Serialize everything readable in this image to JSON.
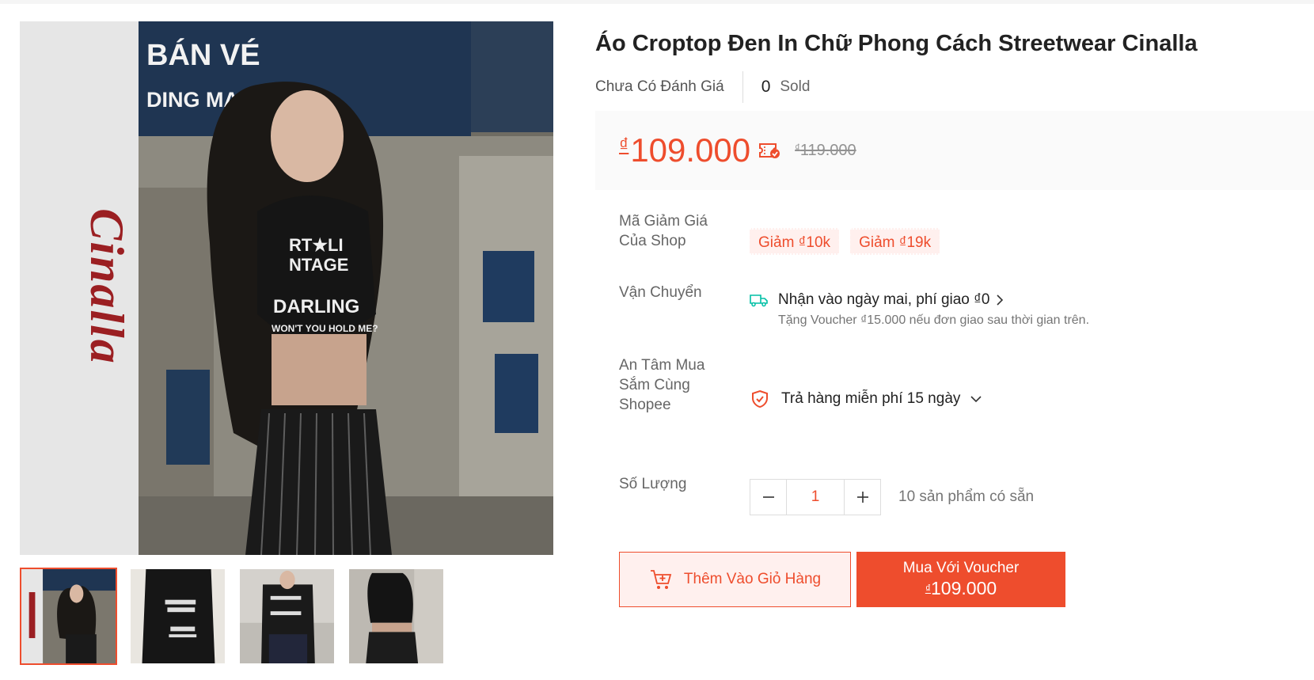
{
  "product": {
    "title": "Áo Croptop Đen In Chữ Phong Cách Streetwear Cinalla",
    "rating_text": "Chưa Có Đánh Giá",
    "sold_count": "0",
    "sold_label": "Sold"
  },
  "price": {
    "currency": "₫",
    "current": "109.000",
    "original_currency": "₫",
    "original": "119.000"
  },
  "gallery": {
    "brand_text": "Cinalla",
    "sign_line1": "BÁN VÉ",
    "sign_line2": "DING MACHINE",
    "shirt_line1": "RT★LI",
    "shirt_line2": "NTAGE",
    "shirt_line3": "DARLING",
    "shirt_line4": "WON'T YOU HOLD ME?",
    "thumbnails": [
      {
        "name": "thumbnail-1",
        "active": true
      },
      {
        "name": "thumbnail-2",
        "active": false
      },
      {
        "name": "thumbnail-3",
        "active": false
      },
      {
        "name": "thumbnail-4",
        "active": false
      }
    ]
  },
  "vouchers": {
    "label": "Mã Giảm Giá Của Shop",
    "items": [
      "Giảm ₫10k",
      "Giảm ₫19k"
    ]
  },
  "shipping": {
    "label": "Vận Chuyển",
    "main": "Nhận vào ngày mai, phí giao ₫0",
    "sub": "Tặng Voucher ₫15.000 nếu đơn giao sau thời gian trên."
  },
  "guarantee": {
    "label": "An Tâm Mua Sắm Cùng Shopee",
    "text": "Trả hàng miễn phí 15 ngày"
  },
  "quantity": {
    "label": "Số Lượng",
    "value": "1",
    "available": "10 sản phẩm có sẵn"
  },
  "actions": {
    "add_to_cart": "Thêm Vào Giỏ Hàng",
    "buy_line1": "Mua Với Voucher",
    "buy_currency": "₫",
    "buy_price": "109.000"
  },
  "colors": {
    "accent": "#ee4d2d",
    "voucher_bg": "#fff0ee",
    "shield": "#ee4d2d",
    "truck": "#00bfa5"
  },
  "icons": [
    "tag-check-icon",
    "truck-icon",
    "chevron-right-icon",
    "shield-check-icon",
    "chevron-down-icon",
    "minus-icon",
    "plus-icon",
    "add-to-cart-icon"
  ]
}
